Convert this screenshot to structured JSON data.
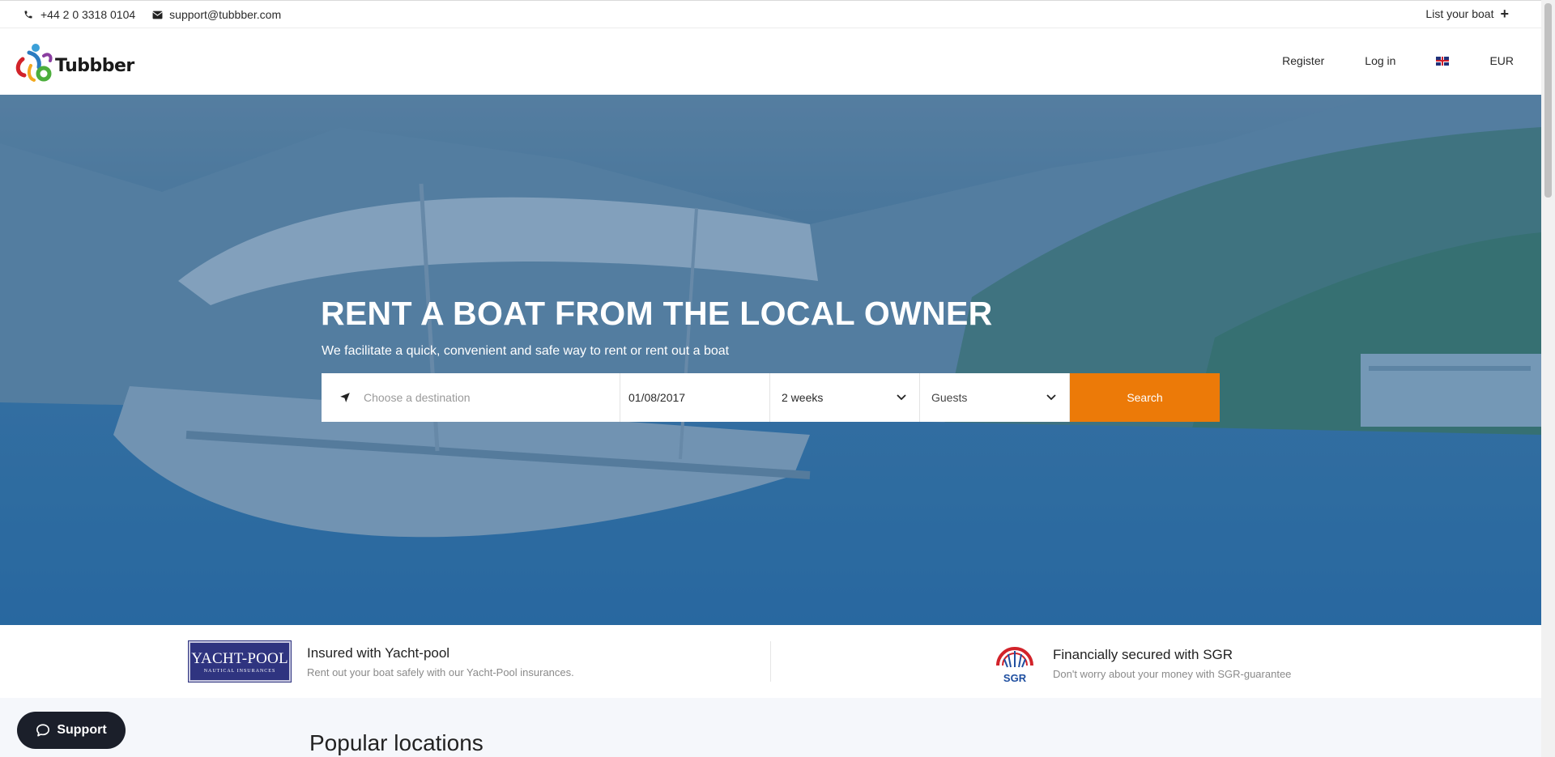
{
  "topbar": {
    "phone": "+44 2 0 3318 0104",
    "email": "support@tubbber.com",
    "list_boat": "List your boat",
    "list_boat_icon": "plus-icon"
  },
  "header": {
    "logo_text": "Tubbber",
    "register": "Register",
    "login": "Log in",
    "language_icon": "uk-flag-icon",
    "currency": "EUR"
  },
  "hero": {
    "title": "RENT A BOAT FROM THE LOCAL OWNER",
    "subtitle": "We facilitate a quick, convenient and safe way to rent or rent out a boat"
  },
  "search": {
    "destination_placeholder": "Choose a destination",
    "date": "01/08/2017",
    "duration": "2 weeks",
    "guests": "Guests",
    "button": "Search"
  },
  "trust": {
    "yachtpool": {
      "logo_big": "YACHT-POOL",
      "logo_small": "NAUTICAL INSURANCES",
      "title": "Insured with Yacht-pool",
      "desc": "Rent out your boat safely with our Yacht-Pool insurances."
    },
    "sgr": {
      "logo_text": "SGR",
      "title": "Financially secured with SGR",
      "desc": "Don't worry about your money with SGR-guarantee"
    }
  },
  "popular": {
    "heading": "Popular locations"
  },
  "support": {
    "label": "Support"
  },
  "colors": {
    "accent": "#ec7a08",
    "support_bg": "#1b1f2a",
    "hero_overlay": "#265e96"
  }
}
